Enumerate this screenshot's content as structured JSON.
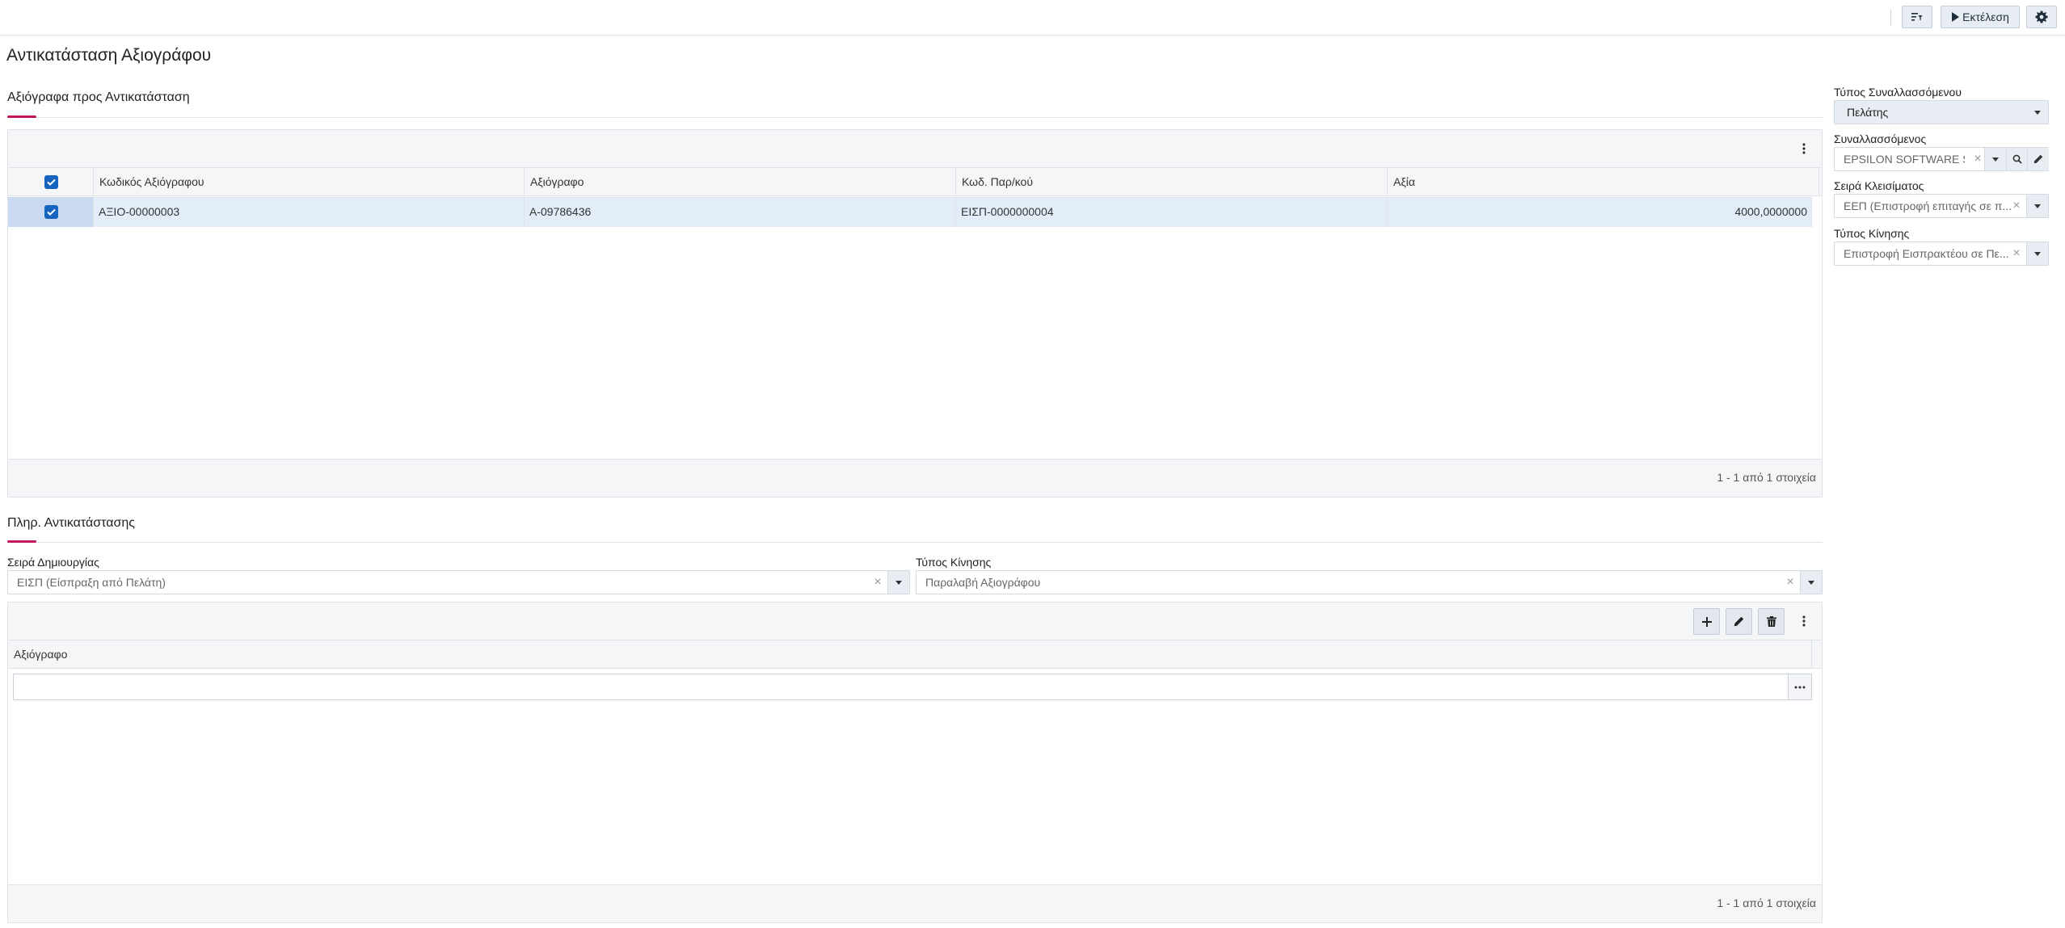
{
  "toolbar": {
    "filter_icon": "filter-list-icon",
    "run_label": "Εκτέλεση",
    "settings_icon": "gear-icon"
  },
  "page_title": "Αντικατάσταση Αξιογράφου",
  "section1": {
    "title": "Αξιόγραφα προς Αντικατάσταση",
    "columns": [
      "Κωδικός Αξιόγραφου",
      "Αξιόγραφο",
      "Κωδ. Παρ/κού",
      "Αξία"
    ],
    "rows": [
      {
        "selected": true,
        "code": "ΑΞΙΟ-00000003",
        "document": "Α-09786436",
        "receipt_code": "ΕΙΣΠ-0000000004",
        "value": "4000,0000000"
      }
    ],
    "pager": "1 - 1 από 1 στοιχεία"
  },
  "section2": {
    "title": "Πληρ. Αντικατάστασης",
    "creation_series_label": "Σειρά Δημιουργίας",
    "creation_series_value": "ΕΙΣΠ (Είσπραξη από Πελάτη)",
    "movement_type_label": "Τύπος Κίνησης",
    "movement_type_value": "Παραλαβή Αξιογράφου",
    "grid_column": "Αξιόγραφο",
    "input_value": "",
    "pager": "1 - 1 από 1 στοιχεία"
  },
  "side": {
    "partner_type_label": "Τύπος Συναλλασσόμενου",
    "partner_type_value": "Πελάτης",
    "partner_label": "Συναλλασσόμενος",
    "partner_value": "EPSILON SOFTWARE SA",
    "closing_series_label": "Σειρά Κλεισίματος",
    "closing_series_value": "ΕΕΠ (Επιστροφή επιταγής σε π...",
    "movement_label": "Τύπος Κίνησης",
    "movement_value": "Επιστροφή Εισπρακτέου σε Πε..."
  },
  "colors": {
    "accent": "#c2185b",
    "selection": "#e3ecf9",
    "checkbox": "#1565c0",
    "button_bg": "#e8edf3"
  }
}
